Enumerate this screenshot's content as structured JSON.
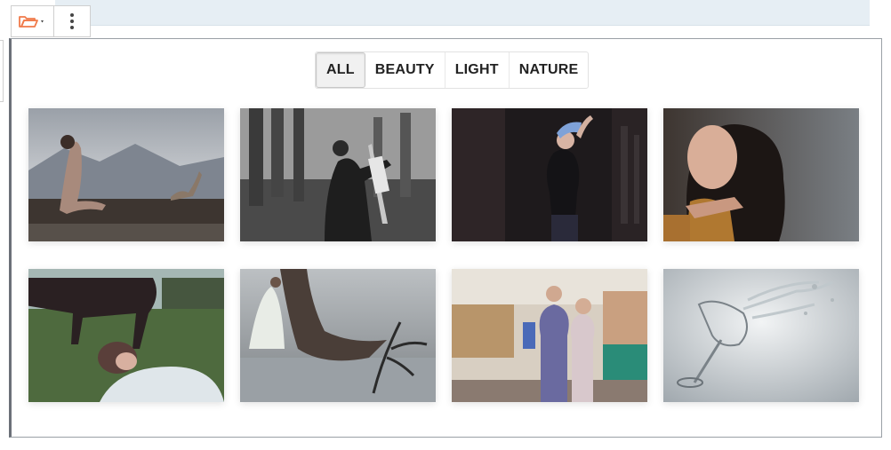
{
  "toolbar": {
    "folder_icon": "folder-open-icon",
    "dropdown_icon": "caret-down-icon",
    "more_icon": "vertical-ellipsis-icon",
    "accent_color": "#f07a4a"
  },
  "gallery": {
    "filters": [
      {
        "label": "ALL",
        "active": true
      },
      {
        "label": "BEAUTY",
        "active": false
      },
      {
        "label": "LIGHT",
        "active": false
      },
      {
        "label": "NATURE",
        "active": false
      }
    ],
    "images": [
      {
        "subject": "woman sitting on log with cat, misty mountains"
      },
      {
        "subject": "woman painting at easel in misty forest, grayscale"
      },
      {
        "subject": "woman in dark street holding scarf"
      },
      {
        "subject": "woman portrait with long dark hair"
      },
      {
        "subject": "woman lying in grass with horse"
      },
      {
        "subject": "woman in white dress by large tree over misty lake"
      },
      {
        "subject": "two women shopping in mall"
      },
      {
        "subject": "wine glass with water splash"
      }
    ]
  }
}
